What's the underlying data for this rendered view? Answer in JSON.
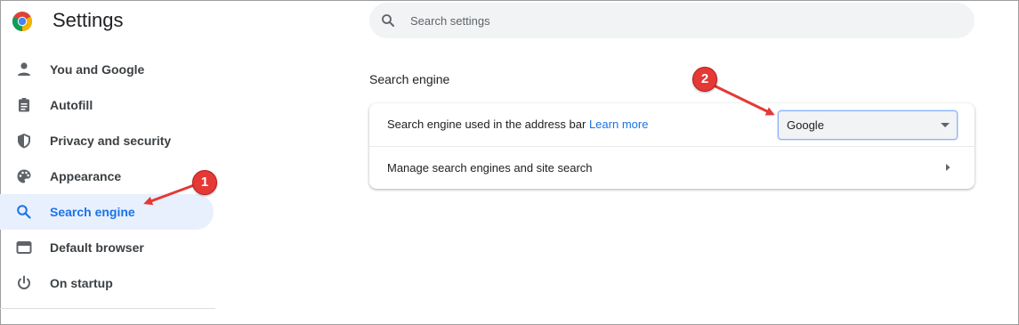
{
  "app": {
    "title": "Settings"
  },
  "sidebar": {
    "items": [
      {
        "label": "You and Google",
        "icon": "person-icon"
      },
      {
        "label": "Autofill",
        "icon": "clipboard-icon"
      },
      {
        "label": "Privacy and security",
        "icon": "shield-icon"
      },
      {
        "label": "Appearance",
        "icon": "palette-icon"
      },
      {
        "label": "Search engine",
        "icon": "search-icon",
        "active": true
      },
      {
        "label": "Default browser",
        "icon": "browser-window-icon"
      },
      {
        "label": "On startup",
        "icon": "power-icon"
      }
    ]
  },
  "search": {
    "placeholder": "Search settings",
    "value": ""
  },
  "main": {
    "section_title": "Search engine",
    "row1": {
      "text": "Search engine used in the address bar",
      "link": "Learn more",
      "select_value": "Google"
    },
    "row2": {
      "text": "Manage search engines and site search"
    }
  },
  "annotations": [
    {
      "label": "1"
    },
    {
      "label": "2"
    }
  ],
  "colors": {
    "accent": "#1a73e8",
    "active_bg": "#e8f0fe",
    "annotation_red": "#e53935",
    "search_bg": "#f1f3f4"
  }
}
